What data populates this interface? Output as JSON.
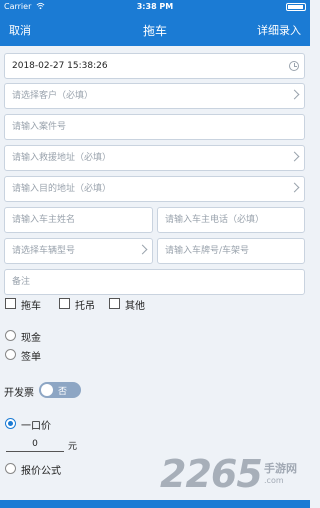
{
  "status_bar": {
    "carrier": "Carrier",
    "time": "3:38 PM"
  },
  "nav": {
    "cancel": "取消",
    "title": "拖车",
    "detail_entry": "详细录入"
  },
  "form": {
    "datetime": "2018-02-27 15:38:26",
    "customer_placeholder": "请选择客户（必填）",
    "case_no_placeholder": "请输入案件号",
    "rescue_address_placeholder": "请输入救援地址（必填）",
    "destination_placeholder": "请输入目的地址（必填）",
    "owner_name_placeholder": "请输入车主姓名",
    "owner_phone_placeholder": "请输入车主电话（必填）",
    "vehicle_model_placeholder": "请选择车辆型号",
    "plate_placeholder": "请输入车牌号/车架号",
    "remark_placeholder": "备注"
  },
  "service_types": [
    "拖车",
    "托吊",
    "其他"
  ],
  "payment": {
    "cash": "现金",
    "sign": "签单"
  },
  "invoice": {
    "label": "开发票",
    "toggle_text": "否"
  },
  "pricing": {
    "fixed_price": "一口价",
    "amount": "0",
    "unit": "元",
    "formula": "报价公式"
  },
  "watermark": {
    "number": "2265",
    "site": "手游网",
    "url": ".com"
  },
  "colors": {
    "primary": "#1b7bd4",
    "background": "#eef2f7"
  }
}
